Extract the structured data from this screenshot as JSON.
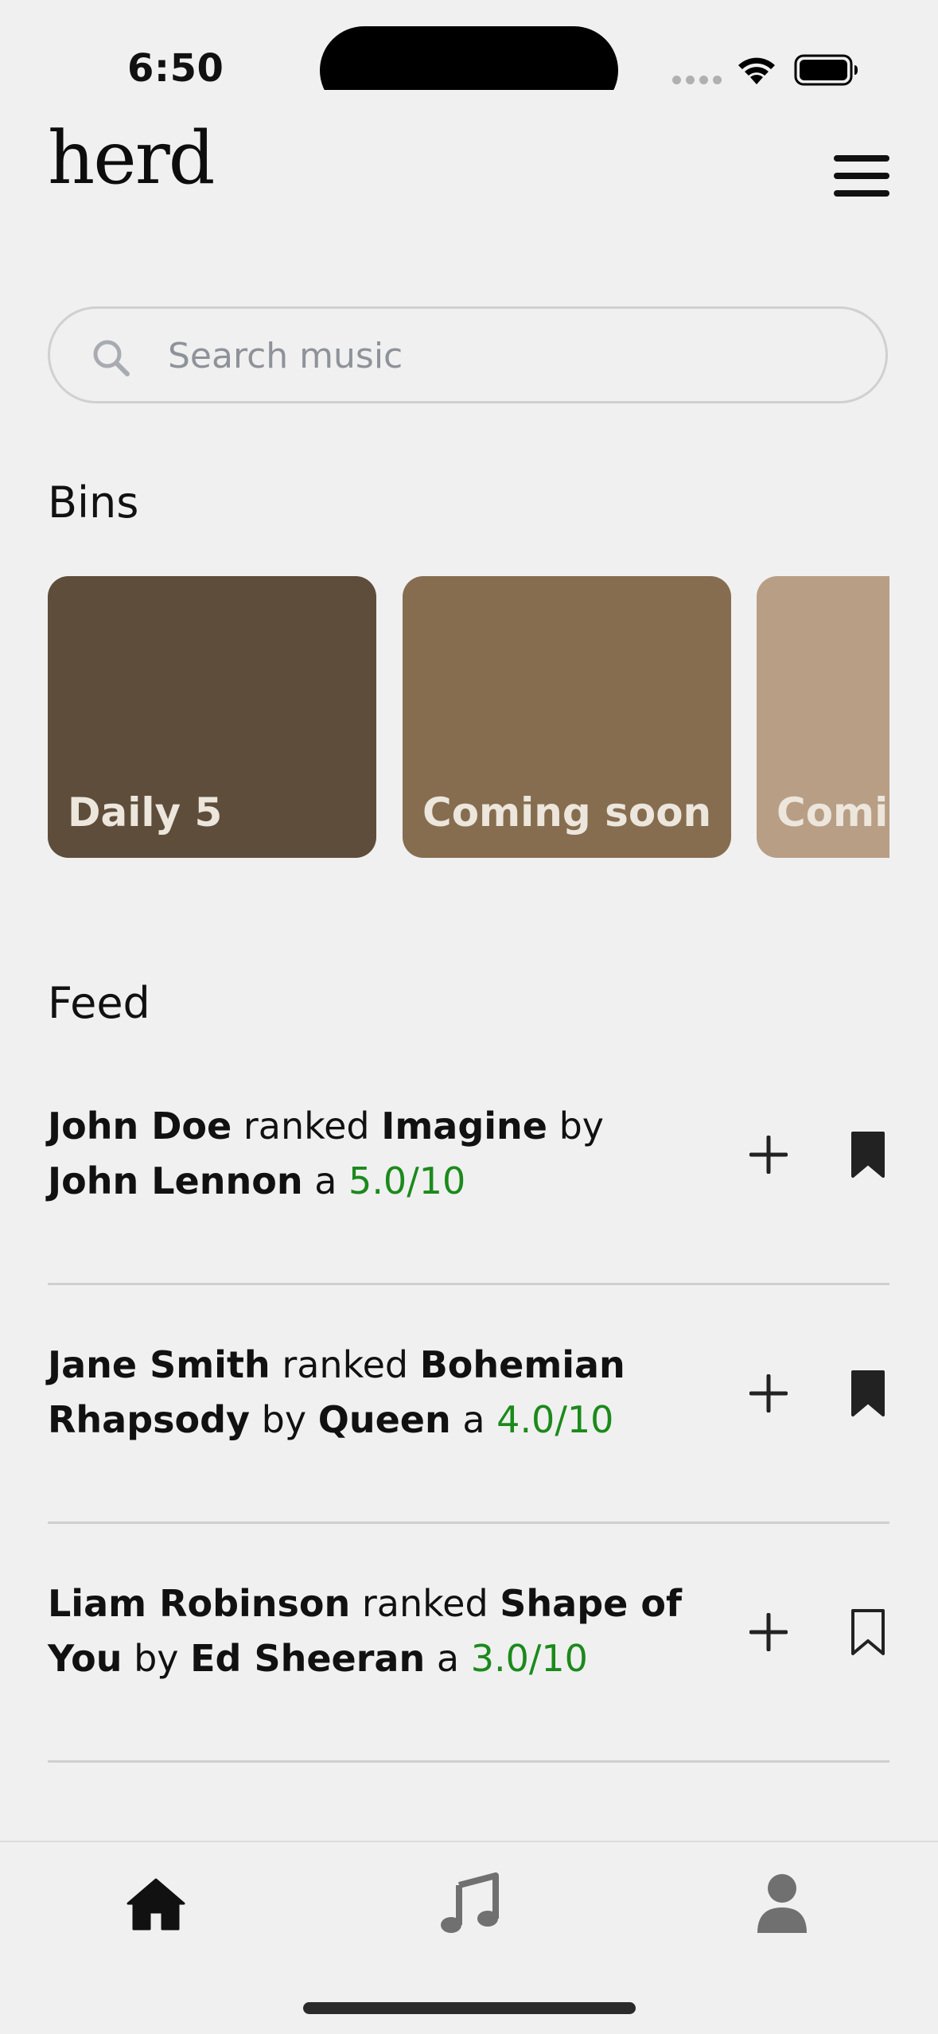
{
  "status_bar": {
    "time": "6:50"
  },
  "header": {
    "logo": "herd",
    "menu_icon": "hamburger-menu-icon"
  },
  "search": {
    "placeholder": "Search music",
    "value": "",
    "icon": "search-icon"
  },
  "bins": {
    "title": "Bins",
    "items": [
      {
        "label": "Daily 5",
        "color": "#5e4d3a"
      },
      {
        "label": "Coming soon",
        "color": "#866d50"
      },
      {
        "label": "Coming soon",
        "color": "#b89e85"
      }
    ]
  },
  "feed": {
    "title": "Feed",
    "score_color": "#1b8a1b",
    "items": [
      {
        "user": "John Doe",
        "verb": "ranked",
        "song": "Imagine",
        "by": "by",
        "artist": "John Lennon",
        "article": "a",
        "score": "5.0/10",
        "bookmarked": true
      },
      {
        "user": "Jane Smith",
        "verb": "ranked",
        "song": "Bohemian Rhapsody",
        "by": "by",
        "artist": "Queen",
        "article": "a",
        "score": "4.0/10",
        "bookmarked": true
      },
      {
        "user": "Liam Robinson",
        "verb": "ranked",
        "song": "Shape of You",
        "by": "by",
        "artist": "Ed Sheeran",
        "article": "a",
        "score": "3.0/10",
        "bookmarked": false
      }
    ]
  },
  "tab_bar": {
    "tabs": [
      {
        "icon": "home-icon",
        "active": true
      },
      {
        "icon": "music-note-icon",
        "active": false
      },
      {
        "icon": "profile-icon",
        "active": false
      }
    ]
  }
}
